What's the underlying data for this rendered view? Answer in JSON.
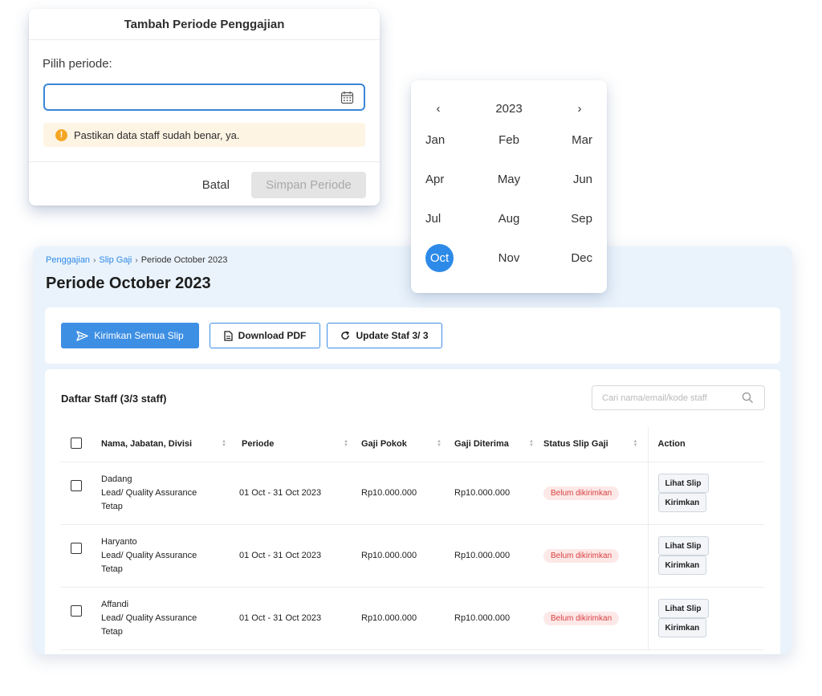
{
  "modal": {
    "title": "Tambah Periode Penggajian",
    "label": "Pilih periode:",
    "input_value": "",
    "alert_text": "Pastikan data staff sudah benar, ya.",
    "cancel_label": "Batal",
    "save_label": "Simpan Periode"
  },
  "picker": {
    "year": "2023",
    "prev": "‹",
    "next": "›",
    "months": [
      "Jan",
      "Feb",
      "Mar",
      "Apr",
      "May",
      "Jun",
      "Jul",
      "Aug",
      "Sep",
      "Oct",
      "Nov",
      "Dec"
    ],
    "selected": "Oct"
  },
  "breadcrumb": {
    "items": [
      "Penggajian",
      "Slip Gaji",
      "Periode October 2023"
    ],
    "separator": "›"
  },
  "page_title": "Periode October 2023",
  "toolbar": {
    "send_all_label": "Kirimkan Semua Slip",
    "pdf_label": "Download PDF",
    "update_label": "Update Staf 3/ 3"
  },
  "list": {
    "title": "Daftar Staff (3/3 staff)",
    "search_placeholder": "Cari nama/email/kode staff",
    "columns": [
      "Nama, Jabatan, Divisi",
      "Periode",
      "Gaji Pokok",
      "Gaji Diterima",
      "Status Slip Gaji",
      "Action"
    ],
    "rows": [
      {
        "name": "Dadang",
        "role": "Lead/ Quality Assurance",
        "division": "Tetap",
        "periode": "01 Oct - 31 Oct 2023",
        "gaji_pokok": "Rp10.000.000",
        "gaji_diterima": "Rp10.000.000",
        "status": "Belum dikirimkan",
        "action_view": "Lihat Slip",
        "action_send": "Kirimkan"
      },
      {
        "name": "Haryanto",
        "role": "Lead/ Quality Assurance",
        "division": "Tetap",
        "periode": "01 Oct - 31 Oct 2023",
        "gaji_pokok": "Rp10.000.000",
        "gaji_diterima": "Rp10.000.000",
        "status": "Belum dikirimkan",
        "action_view": "Lihat Slip",
        "action_send": "Kirimkan"
      },
      {
        "name": "Affandi",
        "role": "Lead/ Quality Assurance",
        "division": "Tetap",
        "periode": "01 Oct - 31 Oct 2023",
        "gaji_pokok": "Rp10.000.000",
        "gaji_diterima": "Rp10.000.000",
        "status": "Belum dikirimkan",
        "action_view": "Lihat Slip",
        "action_send": "Kirimkan"
      }
    ]
  },
  "colors": {
    "primary": "#3d8fe4",
    "selected_month": "#2d8ae8",
    "badge_bg": "#fde8e8",
    "badge_text": "#d94040",
    "alert_bg": "#fef4e4",
    "panel_bg": "#eaf3fc"
  },
  "icons": [
    "calendar-icon",
    "info-icon",
    "chevron-left-icon",
    "chevron-right-icon",
    "send-icon",
    "document-icon",
    "refresh-icon",
    "search-icon",
    "sort-icon"
  ]
}
